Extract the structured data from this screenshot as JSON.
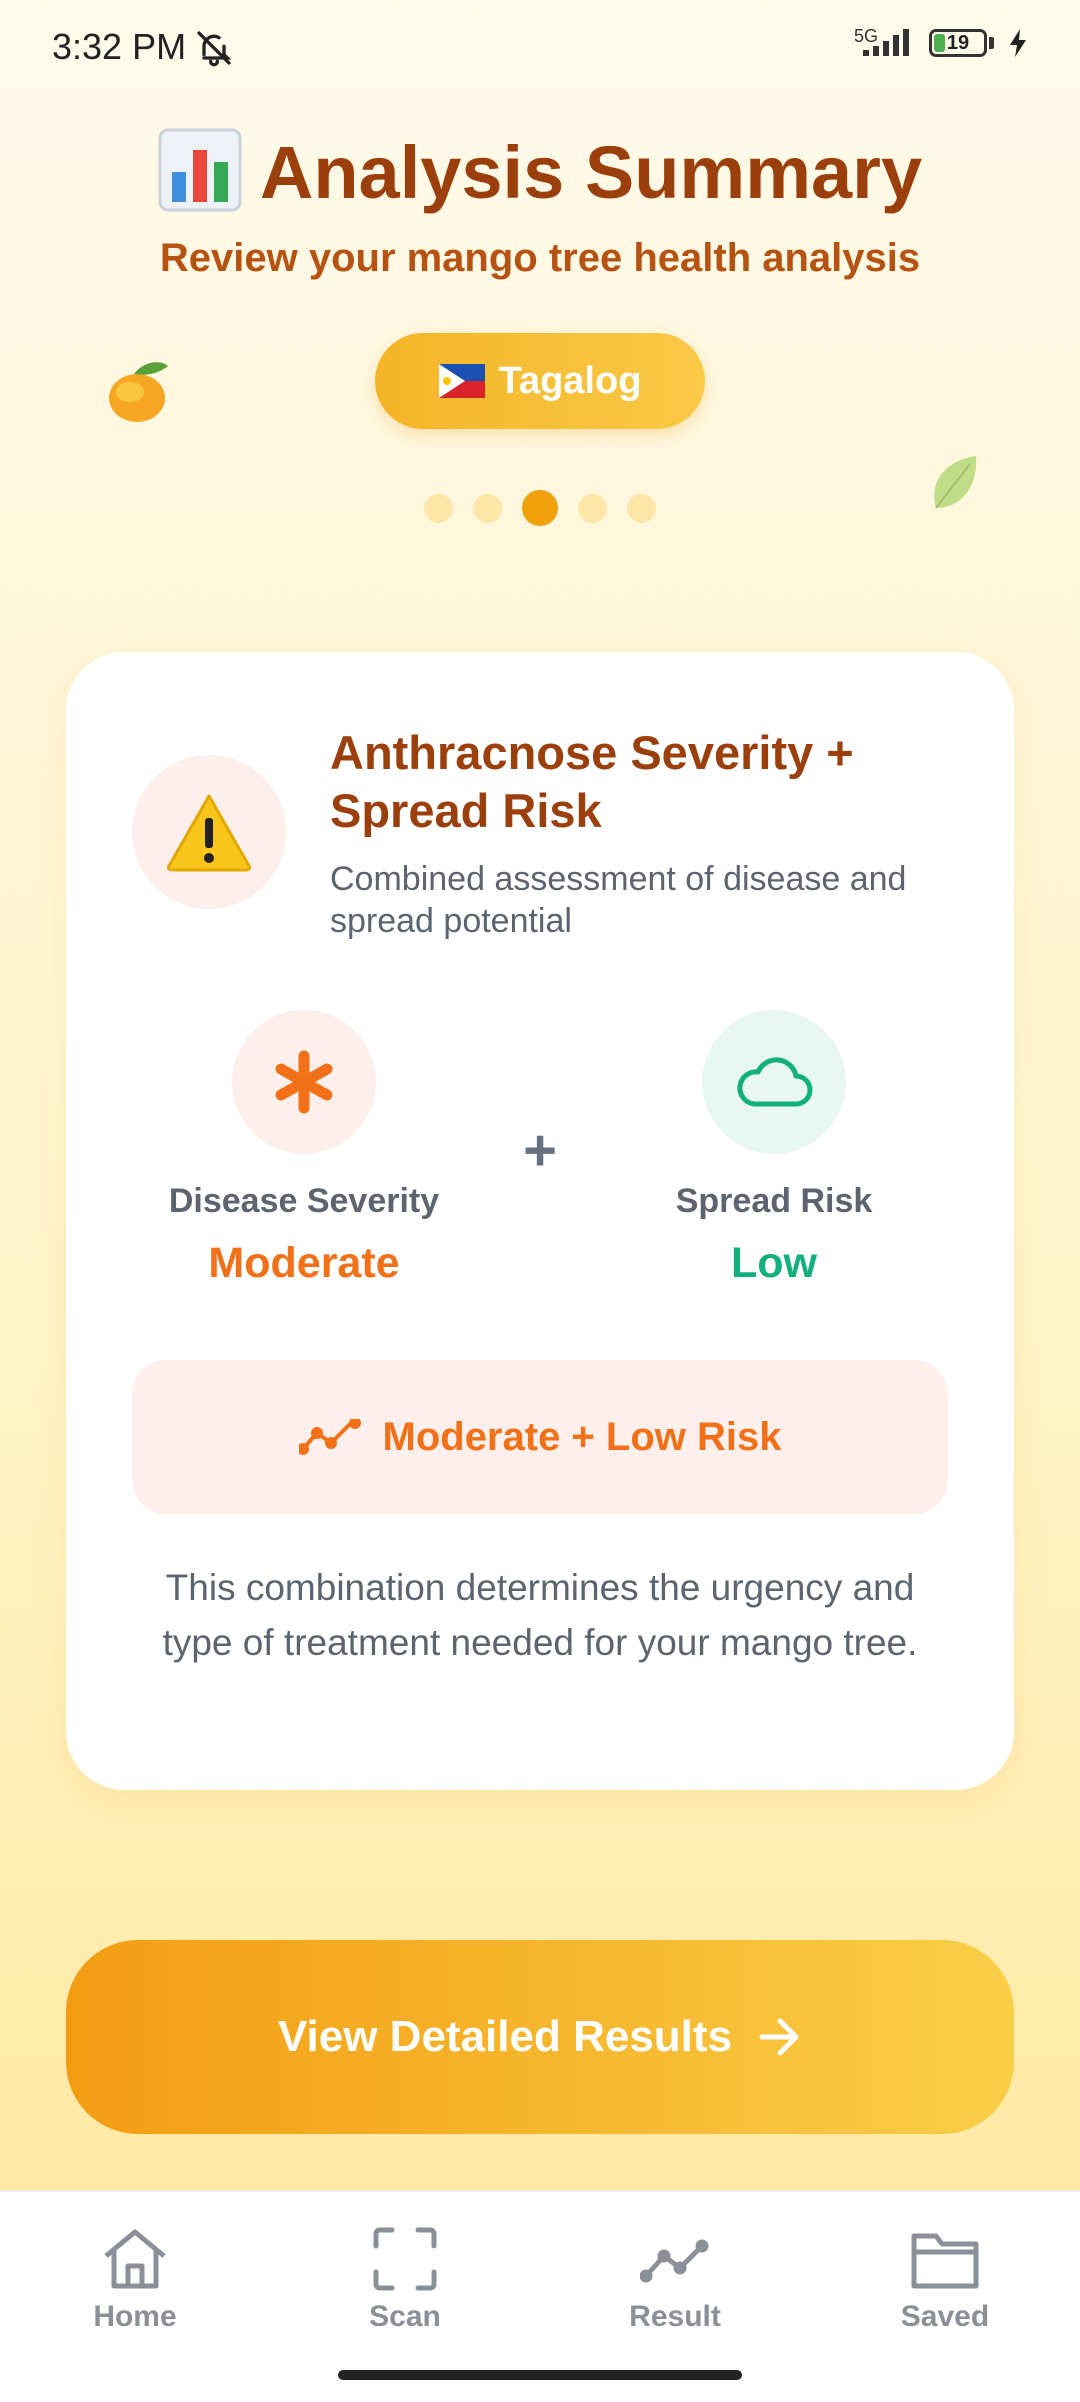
{
  "status_bar": {
    "time": "3:32 PM",
    "network": "5G",
    "battery": "19",
    "battery_level": 0.19,
    "icons": [
      "bell-off-icon",
      "signal-icon",
      "battery-icon",
      "charging-icon"
    ]
  },
  "header": {
    "title": "Analysis Summary",
    "title_icon": "bar-chart-icon",
    "subtitle": "Review your mango tree health analysis",
    "language_button": "Tagalog",
    "language_flag": "philippines-flag-icon"
  },
  "carousel": {
    "total": 5,
    "active_index": 2
  },
  "card": {
    "icon": "warning-icon",
    "title": "Anthracnose Severity + Spread Risk",
    "description": "Combined assessment of disease and spread potential",
    "severity": {
      "label": "Disease Severity",
      "value": "Moderate",
      "color": "#f27018",
      "icon": "asterisk-icon"
    },
    "plus": "+",
    "spread": {
      "label": "Spread Risk",
      "value": "Low",
      "color": "#12b07a",
      "icon": "cloud-icon"
    },
    "combination": {
      "text": "Moderate + Low Risk",
      "icon": "trend-line-icon"
    },
    "note": "This combination determines the urgency and type of treatment needed for your mango tree."
  },
  "cta": {
    "label": "View Detailed Results",
    "icon": "arrow-right-icon"
  },
  "bottom_nav": {
    "items": [
      {
        "label": "Home",
        "icon": "home-icon"
      },
      {
        "label": "Scan",
        "icon": "scan-icon"
      },
      {
        "label": "Result",
        "icon": "trend-line-icon"
      },
      {
        "label": "Saved",
        "icon": "folder-icon"
      }
    ]
  },
  "colors": {
    "title": "#9b3f0c",
    "accent_orange": "#f27018",
    "accent_green": "#12b07a",
    "button_gradient_start": "#f39c12",
    "button_gradient_end": "#f9cf47"
  }
}
